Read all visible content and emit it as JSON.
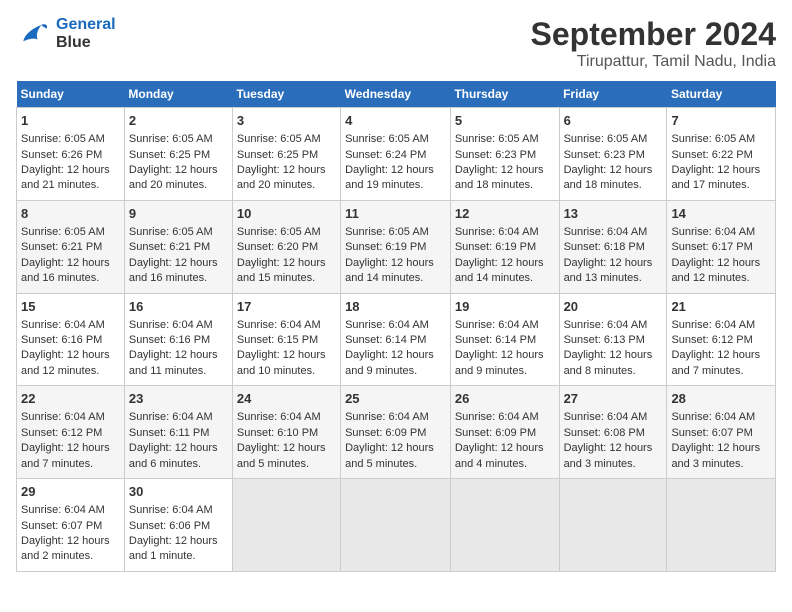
{
  "header": {
    "logo_line1": "General",
    "logo_line2": "Blue",
    "title": "September 2024",
    "subtitle": "Tirupattur, Tamil Nadu, India"
  },
  "calendar": {
    "weekdays": [
      "Sunday",
      "Monday",
      "Tuesday",
      "Wednesday",
      "Thursday",
      "Friday",
      "Saturday"
    ],
    "weeks": [
      [
        {
          "day": "1",
          "sunrise": "6:05 AM",
          "sunset": "6:26 PM",
          "daylight": "12 hours and 21 minutes."
        },
        {
          "day": "2",
          "sunrise": "6:05 AM",
          "sunset": "6:25 PM",
          "daylight": "12 hours and 20 minutes."
        },
        {
          "day": "3",
          "sunrise": "6:05 AM",
          "sunset": "6:25 PM",
          "daylight": "12 hours and 20 minutes."
        },
        {
          "day": "4",
          "sunrise": "6:05 AM",
          "sunset": "6:24 PM",
          "daylight": "12 hours and 19 minutes."
        },
        {
          "day": "5",
          "sunrise": "6:05 AM",
          "sunset": "6:23 PM",
          "daylight": "12 hours and 18 minutes."
        },
        {
          "day": "6",
          "sunrise": "6:05 AM",
          "sunset": "6:23 PM",
          "daylight": "12 hours and 18 minutes."
        },
        {
          "day": "7",
          "sunrise": "6:05 AM",
          "sunset": "6:22 PM",
          "daylight": "12 hours and 17 minutes."
        }
      ],
      [
        {
          "day": "8",
          "sunrise": "6:05 AM",
          "sunset": "6:21 PM",
          "daylight": "12 hours and 16 minutes."
        },
        {
          "day": "9",
          "sunrise": "6:05 AM",
          "sunset": "6:21 PM",
          "daylight": "12 hours and 16 minutes."
        },
        {
          "day": "10",
          "sunrise": "6:05 AM",
          "sunset": "6:20 PM",
          "daylight": "12 hours and 15 minutes."
        },
        {
          "day": "11",
          "sunrise": "6:05 AM",
          "sunset": "6:19 PM",
          "daylight": "12 hours and 14 minutes."
        },
        {
          "day": "12",
          "sunrise": "6:04 AM",
          "sunset": "6:19 PM",
          "daylight": "12 hours and 14 minutes."
        },
        {
          "day": "13",
          "sunrise": "6:04 AM",
          "sunset": "6:18 PM",
          "daylight": "12 hours and 13 minutes."
        },
        {
          "day": "14",
          "sunrise": "6:04 AM",
          "sunset": "6:17 PM",
          "daylight": "12 hours and 12 minutes."
        }
      ],
      [
        {
          "day": "15",
          "sunrise": "6:04 AM",
          "sunset": "6:16 PM",
          "daylight": "12 hours and 12 minutes."
        },
        {
          "day": "16",
          "sunrise": "6:04 AM",
          "sunset": "6:16 PM",
          "daylight": "12 hours and 11 minutes."
        },
        {
          "day": "17",
          "sunrise": "6:04 AM",
          "sunset": "6:15 PM",
          "daylight": "12 hours and 10 minutes."
        },
        {
          "day": "18",
          "sunrise": "6:04 AM",
          "sunset": "6:14 PM",
          "daylight": "12 hours and 9 minutes."
        },
        {
          "day": "19",
          "sunrise": "6:04 AM",
          "sunset": "6:14 PM",
          "daylight": "12 hours and 9 minutes."
        },
        {
          "day": "20",
          "sunrise": "6:04 AM",
          "sunset": "6:13 PM",
          "daylight": "12 hours and 8 minutes."
        },
        {
          "day": "21",
          "sunrise": "6:04 AM",
          "sunset": "6:12 PM",
          "daylight": "12 hours and 7 minutes."
        }
      ],
      [
        {
          "day": "22",
          "sunrise": "6:04 AM",
          "sunset": "6:12 PM",
          "daylight": "12 hours and 7 minutes."
        },
        {
          "day": "23",
          "sunrise": "6:04 AM",
          "sunset": "6:11 PM",
          "daylight": "12 hours and 6 minutes."
        },
        {
          "day": "24",
          "sunrise": "6:04 AM",
          "sunset": "6:10 PM",
          "daylight": "12 hours and 5 minutes."
        },
        {
          "day": "25",
          "sunrise": "6:04 AM",
          "sunset": "6:09 PM",
          "daylight": "12 hours and 5 minutes."
        },
        {
          "day": "26",
          "sunrise": "6:04 AM",
          "sunset": "6:09 PM",
          "daylight": "12 hours and 4 minutes."
        },
        {
          "day": "27",
          "sunrise": "6:04 AM",
          "sunset": "6:08 PM",
          "daylight": "12 hours and 3 minutes."
        },
        {
          "day": "28",
          "sunrise": "6:04 AM",
          "sunset": "6:07 PM",
          "daylight": "12 hours and 3 minutes."
        }
      ],
      [
        {
          "day": "29",
          "sunrise": "6:04 AM",
          "sunset": "6:07 PM",
          "daylight": "12 hours and 2 minutes."
        },
        {
          "day": "30",
          "sunrise": "6:04 AM",
          "sunset": "6:06 PM",
          "daylight": "12 hours and 1 minute."
        },
        null,
        null,
        null,
        null,
        null
      ]
    ]
  }
}
